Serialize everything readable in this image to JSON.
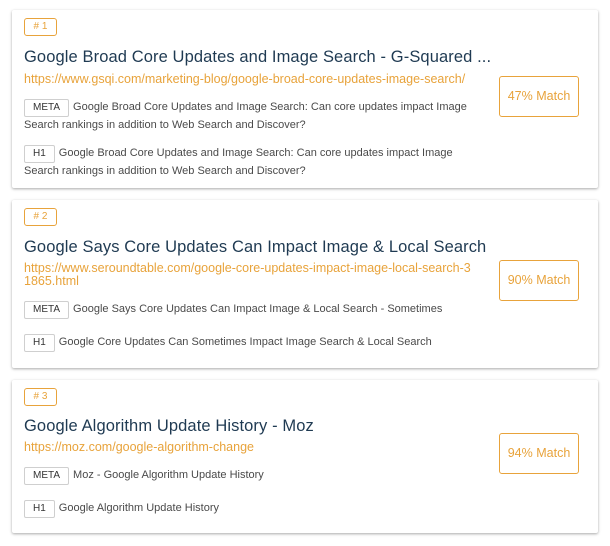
{
  "results": [
    {
      "rank": "# 1",
      "title": "Google Broad Core Updates and Image Search - G-Squared ...",
      "url": "https://www.gsqi.com/marketing-blog/google-broad-core-updates-image-search/",
      "meta_tag": "META",
      "meta_text": "Google Broad Core Updates and Image Search: Can core updates impact Image Search rankings in addition to Web Search and Discover?",
      "h1_tag": "H1",
      "h1_text": "Google Broad Core Updates and Image Search: Can core updates impact Image Search rankings in addition to Web Search and Discover?",
      "match": "47% Match"
    },
    {
      "rank": "# 2",
      "title": "Google Says Core Updates Can Impact Image & Local Search",
      "url": "https://www.seroundtable.com/google-core-updates-impact-image-local-search-31865.html",
      "meta_tag": "META",
      "meta_text": "Google Says Core Updates Can Impact Image & Local Search - Sometimes",
      "h1_tag": "H1",
      "h1_text": "Google Core Updates Can Sometimes Impact Image Search & Local Search",
      "match": "90% Match"
    },
    {
      "rank": "# 3",
      "title": "Google Algorithm Update History - Moz",
      "url": "https://moz.com/google-algorithm-change",
      "meta_tag": "META",
      "meta_text": "Moz - Google Algorithm Update History",
      "h1_tag": "H1",
      "h1_text": "Google Algorithm Update History",
      "match": "94% Match"
    }
  ],
  "colors": {
    "accent": "#e8a33b",
    "title": "#1f3a52",
    "body_text": "#4a4a4a",
    "tag_border": "#cfcfcf"
  }
}
